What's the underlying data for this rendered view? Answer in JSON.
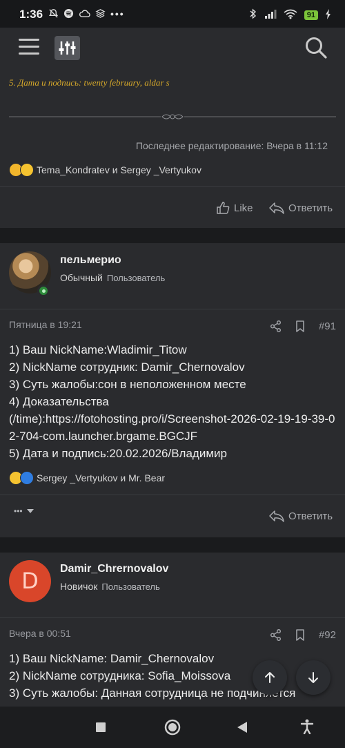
{
  "status_bar": {
    "time": "1:36",
    "battery": "91"
  },
  "post_prev": {
    "signature": "5. Дата и подпись: twenty february, aldar s",
    "edited": "Последнее редактирование: Вчера в 11:12",
    "reactions_text": "Tema_Kondratev и Sergey _Vertyukov",
    "like_label": "Like",
    "reply_label": "Ответить"
  },
  "post_91": {
    "username": "пельмерио",
    "role": "Обычный",
    "subrole": "Пользователь",
    "date": "Пятница в 19:21",
    "number": "#91",
    "lines": [
      "1) Ваш NickName:Wladimir_Titow",
      "2) NickName сотрудник: Damir_Chernovalov",
      "3) Суть жалобы:сон в неположенном месте",
      "4) Доказательства",
      "(/time):https://fotohosting.pro/i/Screenshot-2026-02-19-19-39-02-704-com.launcher.brgame.BGCJF",
      "5) Дата и подпись:20.02.2026/Владимир"
    ],
    "reactions_text": "Sergey _Vertyukov и Mr. Bear",
    "more_label": "•••",
    "reply_label": "Ответить"
  },
  "post_92": {
    "avatar_letter": "D",
    "username": "Damir_Chrernovalov",
    "role": "Новичок",
    "subrole": "Пользователь",
    "date": "Вчера в 00:51",
    "number": "#92",
    "lines": [
      "1) Ваш NickName: Damir_Chernovalov",
      "2) NickName сотрудника: Sofia_Moissova",
      "3) Суть жалобы: Данная сотрудница не подчиняется"
    ]
  },
  "colors": {
    "accent_gold": "#d4a72a",
    "avatar_red": "#d9462a",
    "online_green": "#2d8a3a"
  }
}
